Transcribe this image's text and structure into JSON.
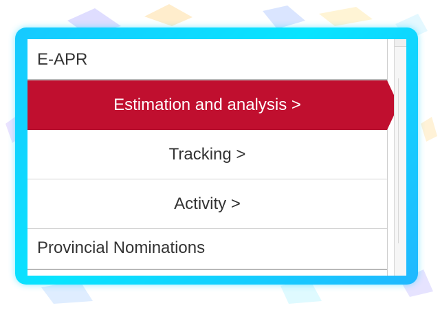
{
  "menu": {
    "header": "E-APR",
    "items": [
      {
        "label": "Estimation and analysis >",
        "active": true
      },
      {
        "label": "Tracking >",
        "active": false
      },
      {
        "label": "Activity >",
        "active": false
      }
    ],
    "footer": "Provincial Nominations"
  },
  "colors": {
    "active_bg": "#c00f2f",
    "frame": "#08e4ff",
    "text": "#333333"
  }
}
